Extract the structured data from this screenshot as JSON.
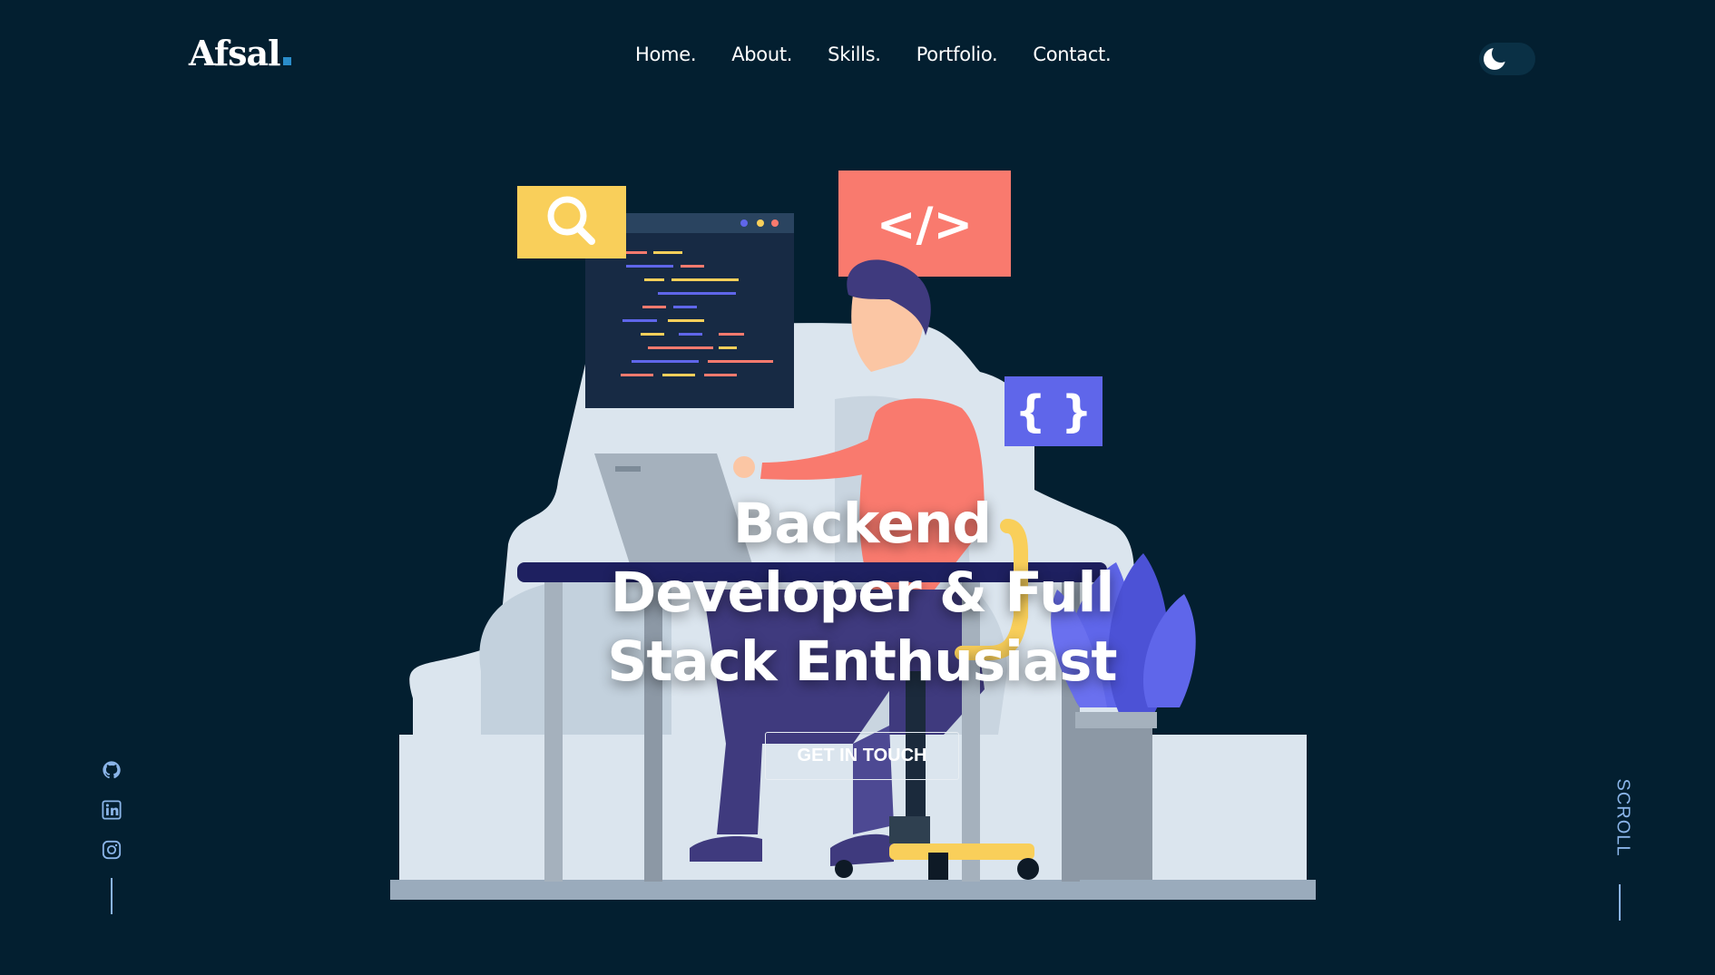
{
  "logo": {
    "text": "Afsal"
  },
  "nav": {
    "items": [
      "Home.",
      "About.",
      "Skills.",
      "Portfolio.",
      "Contact."
    ]
  },
  "theme_toggle": {
    "icon": "moon-icon"
  },
  "hero": {
    "headline_line1": "Backend",
    "headline_line2": "Developer & Full",
    "headline_line3": "Stack Enthusiast",
    "cta_label": "GET IN TOUCH"
  },
  "illustration": {
    "search_icon": "search-icon",
    "code_tag_text": "</>",
    "braces_text": "{ }"
  },
  "social": {
    "icons": [
      "github-icon",
      "linkedin-icon",
      "instagram-icon"
    ]
  },
  "scroll": {
    "label": "SCROLL"
  },
  "colors": {
    "background": "#031f30",
    "accent_blue": "#2a8cc9",
    "soft_blue": "#8ab4e8",
    "coral": "#f97a6e",
    "yellow": "#f9cf5a",
    "indigo": "#5f66ea"
  }
}
